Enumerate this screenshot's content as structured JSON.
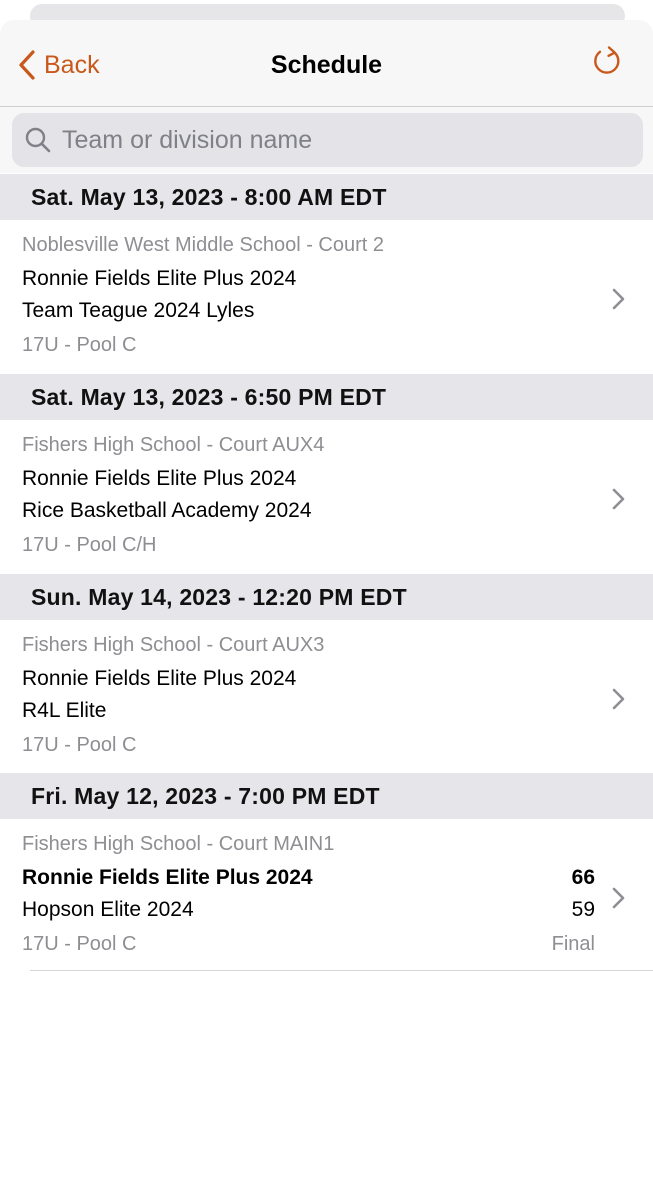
{
  "nav": {
    "back_label": "Back",
    "title": "Schedule",
    "accent_color": "#c8591a"
  },
  "search": {
    "placeholder": "Team or division name",
    "value": ""
  },
  "sections": [
    {
      "header": "Sat. May 13, 2023 - 8:00 AM EDT",
      "game": {
        "location": "Noblesville West Middle School - Court 2",
        "team1": "Ronnie Fields Elite Plus 2024",
        "team2": "Team Teague 2024 Lyles",
        "division": "17U - Pool C"
      }
    },
    {
      "header": "Sat. May 13, 2023 - 6:50 PM EDT",
      "game": {
        "location": "Fishers High School - Court AUX4",
        "team1": "Ronnie Fields Elite Plus 2024",
        "team2": "Rice Basketball Academy 2024",
        "division": "17U - Pool C/H"
      }
    },
    {
      "header": "Sun. May 14, 2023 - 12:20 PM EDT",
      "game": {
        "location": "Fishers High School - Court AUX3",
        "team1": "Ronnie Fields Elite Plus 2024",
        "team2": "R4L Elite",
        "division": "17U - Pool C"
      }
    },
    {
      "header": "Fri. May 12, 2023 - 7:00 PM EDT",
      "game": {
        "location": "Fishers High School - Court MAIN1",
        "team1": "Ronnie Fields Elite Plus 2024",
        "team2": "Hopson Elite 2024",
        "division": "17U - Pool C",
        "score1": "66",
        "score2": "59",
        "status": "Final"
      }
    }
  ],
  "icons": {
    "back": "chevron-left-icon",
    "refresh": "refresh-icon",
    "search": "magnifier-icon",
    "row": "chevron-right-icon"
  }
}
